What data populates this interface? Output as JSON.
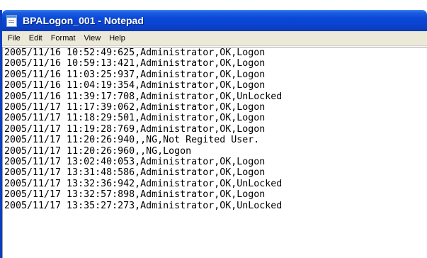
{
  "window": {
    "title": "BPALogon_001 - Notepad"
  },
  "menu": [
    "File",
    "Edit",
    "Format",
    "View",
    "Help"
  ],
  "lines": [
    "2005/11/16 10:52:49:625,Administrator,OK,Logon",
    "2005/11/16 10:59:13:421,Administrator,OK,Logon",
    "2005/11/16 11:03:25:937,Administrator,OK,Logon",
    "2005/11/16 11:04:19:354,Administrator,OK,Logon",
    "2005/11/16 11:39:17:708,Administrator,OK,UnLocked",
    "2005/11/17 11:17:39:062,Administrator,OK,Logon",
    "2005/11/17 11:18:29:501,Administrator,OK,Logon",
    "2005/11/17 11:19:28:769,Administrator,OK,Logon",
    "2005/11/17 11:20:26:940,,NG,Not Regited User.",
    "2005/11/17 11:20:26:960,,NG,Logon",
    "2005/11/17 13:02:40:053,Administrator,OK,Logon",
    "2005/11/17 13:31:48:586,Administrator,OK,Logon",
    "2005/11/17 13:32:36:942,Administrator,OK,UnLocked",
    "2005/11/17 13:32:57:898,Administrator,OK,Logon",
    "2005/11/17 13:35:27:273,Administrator,OK,UnLocked"
  ]
}
